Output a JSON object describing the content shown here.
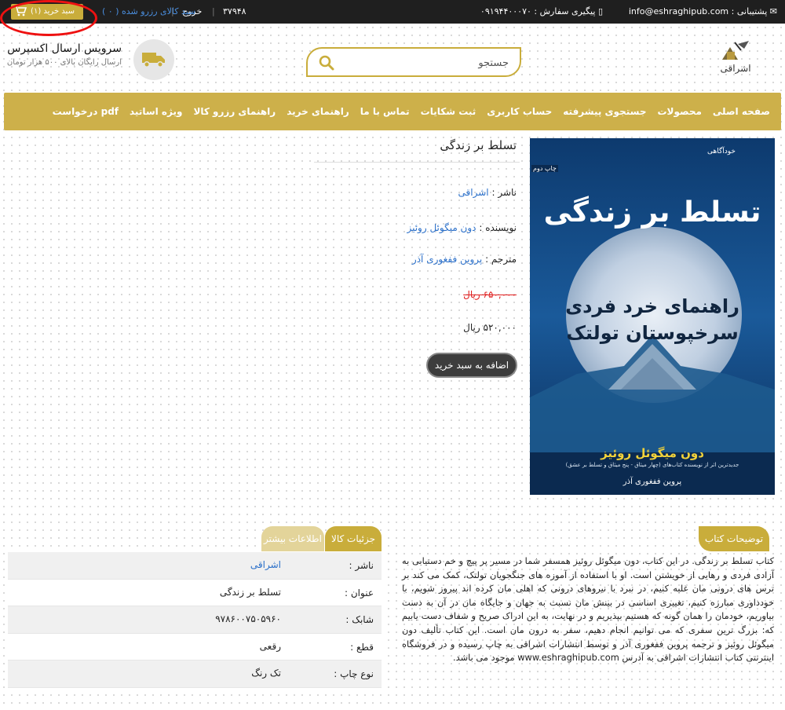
{
  "topbar": {
    "support_label": "پشتیبانی :",
    "support_email": "info@eshraghipub.com",
    "tracking_label": "پیگیری سفارش :",
    "tracking_phone": "۰۹۱۹۴۴۰۰۰۷۰",
    "counter": "۳۷۹۴۸",
    "logout": "خروج",
    "reserved": "سبد کالای رزرو شده ( ۰ )",
    "cart": "سبد خرید (۱)"
  },
  "header": {
    "logo_text": "اشراقی",
    "search_placeholder": "جستجو",
    "express_title": "سرویس ارسال اکسپرس",
    "express_sub": "ارسال رایگان بالای ۵۰۰ هزار تومان"
  },
  "nav": {
    "items": [
      "صفحه اصلی",
      "محصولات",
      "جستجوی پیشرفته",
      "حساب کاربری",
      "ثبت شکایات",
      "تماس با ما",
      "راهنمای خرید",
      "راهنمای رزرو کالا",
      "ویژه اساتید",
      "درخواست pdf"
    ]
  },
  "cover": {
    "edition": "چاپ دوم",
    "badge": "خودآگاهی",
    "title": "تسلط بر زندگی",
    "subtitle_1": "راهنمای خرد فردی",
    "subtitle_2": "سرخپوستان تولتک",
    "author": "دون میگوئل روئیز",
    "tagline": "جدیدترین اثر از نویسنده کتاب‌های (چهار میثاق - پنج میثاق و تسلط بر عشق)",
    "translator": "پروین ففغوری آذر"
  },
  "product": {
    "title": "تسلط بر زندگی",
    "publisher_label": "ناشر :",
    "publisher": "اشراقی",
    "author_label": "نویسنده :",
    "author": "دون میگوئل روئیز",
    "translator_label": "مترجم :",
    "translator": "پروین ففغوری آذر",
    "old_price": "۶۵۰,۰۰۰ ریال",
    "price": "۵۲۰,۰۰۰ ریال",
    "add_to_cart": "اضافه به سبد خرید"
  },
  "description": {
    "tab": "توضیحات کتاب",
    "text": "کتاب تسلط بر زندگی. در این کتاب، دون میگوئل روئیز همسفر شما در مسیر پر پیچ و خم دستیابی به آزادی فردی و رهایی از خویشتن است. او با استفاده از آموزه های جنگجویان تولتک، کمک می کند بر ترس های درونی مان غلبه کنیم، در نبرد با نیروهای درونی که اهلی مان کرده اند پیروز شویم، با خودداوری مبارزه کنیم، تغییری اساسی در بینش مان نسبت به جهان و جایگاه مان در آن به دست بیاوریم، خودمان را همان گونه که هستیم بپذیریم و در نهایت، به این ادراک صریح و شفاف دست یابیم که: بزرگ ترین سفری که می توانیم انجام دهیم، سفر به درون مان است. این کتاب تألیف دون میگوئل روئیز و ترجمه پروین ففغوری آذر و توسط انتشارات اشراقی به چاپ رسیده و در فروشگاه اینترنتی کتاب انتشارات اشراقی به آدرس www.eshraghipub.com موجود می باشد."
  },
  "details": {
    "tab_details": "جزئیات کالا",
    "tab_more": "اطلاعات بیشتر",
    "rows": [
      {
        "label": "ناشر :",
        "value": "اشراقی"
      },
      {
        "label": "عنوان :",
        "value": "تسلط بر زندگی"
      },
      {
        "label": "شابک :",
        "value": "۹۷۸۶۰۰۷۵۰۵۹۶۰"
      },
      {
        "label": "قطع :",
        "value": "رقعی"
      },
      {
        "label": "نوع چاپ :",
        "value": "تک رنگ"
      }
    ]
  },
  "colors": {
    "gold": "#c9ad3b",
    "nav_gold": "#cdb04a",
    "dark_bar": "#1f1f1f",
    "link_blue": "#2a6fc9",
    "old_price_red": "#e02020"
  }
}
